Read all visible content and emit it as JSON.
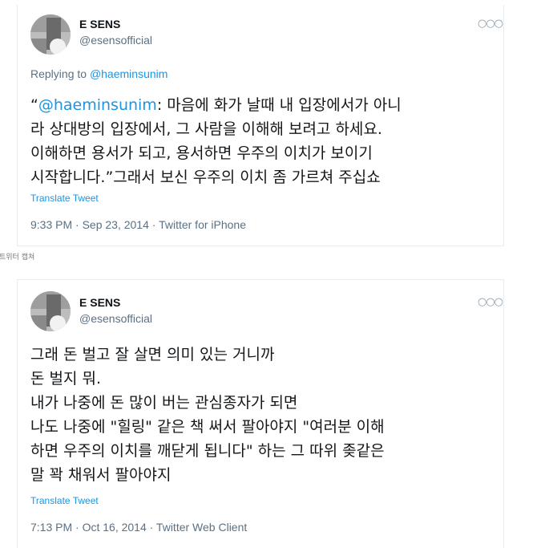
{
  "tweet1": {
    "display_name": "E SENS",
    "handle": "@esensofficial",
    "more_icon": "more-dots-icon",
    "replying_prefix": "Replying to",
    "replying_to": "@haeminsunim",
    "quote_open": "“",
    "mention": "@haeminsunim",
    "line1_rest": ": 마음에 화가 날때 내 입장에서가 아니",
    "line2": "라 상대방의 입장에서, 그 사람을 이해해 보려고 하세요.",
    "line3": "이해하면 용서가 되고, 용서하면 우주의 이치가 보이기",
    "line4": "시작합니다.”그래서 보신 우주의 이치 좀 가르쳐 주십쇼",
    "translate": "Translate Tweet",
    "meta": "9:33 PM · Sep 23, 2014 · Twitter for iPhone"
  },
  "caption": "트위터 캡쳐",
  "tweet2": {
    "display_name": "E SENS",
    "handle": "@esensofficial",
    "more_icon": "more-dots-icon",
    "lines": [
      "그래 돈 벌고 잘 살면 의미 있는 거니까",
      "돈 벌지 뭐.",
      "내가 나중에 돈 많이 버는 관심종자가 되면",
      "나도 나중에 \"힐링\" 같은 책 써서 팔아야지 \"여러분 이해",
      "하면 우주의 이치를 깨닫게 됩니다\" 하는 그 따위 좆같은",
      "말 꽉 채워서 팔아야지"
    ],
    "translate": "Translate Tweet",
    "meta": "7:13 PM · Oct 16, 2014 · Twitter Web Client"
  },
  "colors": {
    "link": "#1b95e0",
    "secondary_text": "#5b7083",
    "primary_text": "#14171a"
  }
}
